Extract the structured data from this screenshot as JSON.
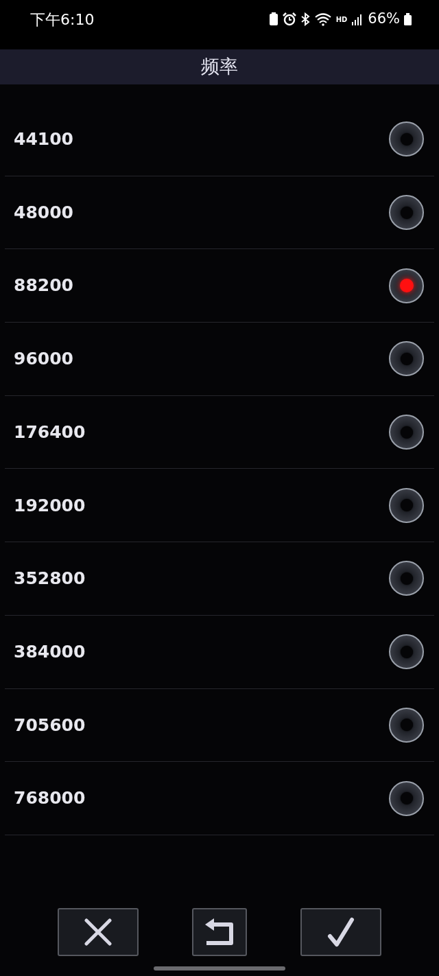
{
  "status_bar": {
    "time": "下午6:10",
    "network_label": "HD",
    "battery": "66%"
  },
  "title": "频率",
  "options": [
    {
      "label": "44100",
      "selected": false
    },
    {
      "label": "48000",
      "selected": false
    },
    {
      "label": "88200",
      "selected": true
    },
    {
      "label": "96000",
      "selected": false
    },
    {
      "label": "176400",
      "selected": false
    },
    {
      "label": "192000",
      "selected": false
    },
    {
      "label": "352800",
      "selected": false
    },
    {
      "label": "384000",
      "selected": false
    },
    {
      "label": "705600",
      "selected": false
    },
    {
      "label": "768000",
      "selected": false
    }
  ],
  "buttons": [
    {
      "kind": "cancel"
    },
    {
      "kind": "reset"
    },
    {
      "kind": "confirm"
    }
  ]
}
